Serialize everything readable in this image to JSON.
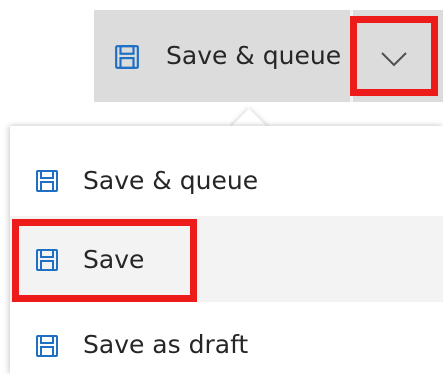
{
  "split_button": {
    "label": "Save & queue",
    "icon": "save-floppy-icon",
    "chevron_icon": "chevron-down-icon"
  },
  "dropdown": {
    "items": [
      {
        "label": "Save & queue",
        "icon": "save-floppy-icon"
      },
      {
        "label": "Save",
        "icon": "save-floppy-icon",
        "hovered": true
      },
      {
        "label": "Save as draft",
        "icon": "save-floppy-icon"
      }
    ]
  },
  "colors": {
    "accent_icon": "#1f6fc4",
    "split_button_bg": "#dcdcdc",
    "menu_hover_bg": "#f3f3f3",
    "highlight": "#ee1b1b",
    "text": "#262626"
  }
}
